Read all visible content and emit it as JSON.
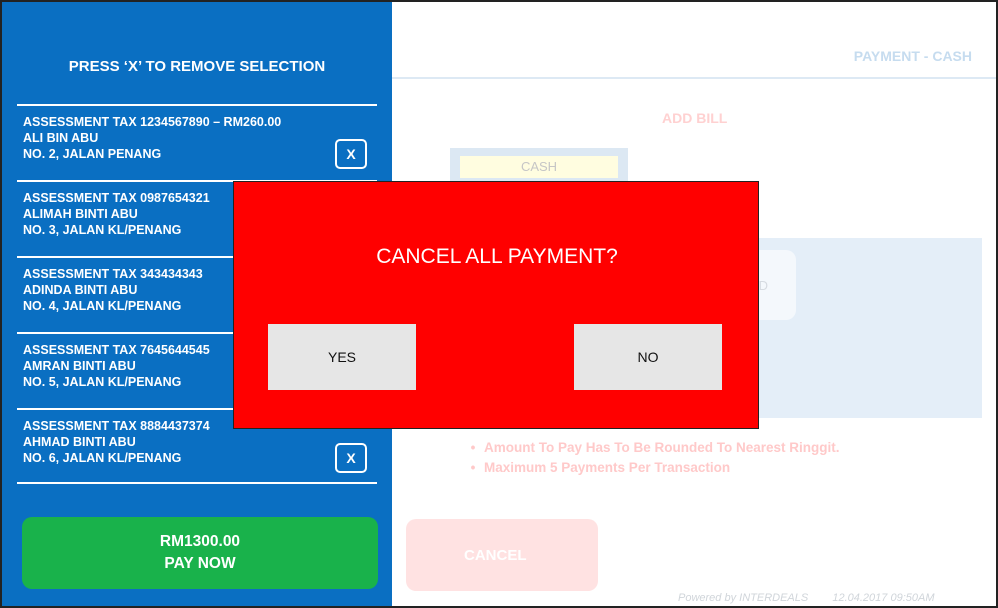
{
  "sidebar": {
    "title": "PRESS ‘X’ TO REMOVE SELECTION",
    "remove_label": "X",
    "bills": [
      {
        "line1": "ASSESSMENT TAX 1234567890   – RM260.00",
        "line2": "ALI BIN ABU",
        "line3": "NO. 2, JALAN PENANG",
        "show_remove": true
      },
      {
        "line1": "ASSESSMENT TAX 0987654321",
        "line2": "ALIMAH BINTI ABU",
        "line3": "NO. 3, JALAN KL/PENANG",
        "show_remove": false
      },
      {
        "line1": "ASSESSMENT TAX 343434343",
        "line2": "ADINDA BINTI ABU",
        "line3": "NO. 4, JALAN KL/PENANG",
        "show_remove": false
      },
      {
        "line1": "ASSESSMENT TAX 7645644545",
        "line2": "AMRAN BINTI ABU",
        "line3": "NO. 5, JALAN KL/PENANG",
        "show_remove": false
      },
      {
        "line1": "ASSESSMENT TAX 8884437374",
        "line2": "AHMAD BINTI ABU",
        "line3": "NO. 6, JALAN KL/PENANG",
        "show_remove": true
      }
    ],
    "total": "RM1300.00",
    "pay_label": "PAY NOW"
  },
  "main": {
    "header": "PAYMENT - CASH",
    "add_bill": "ADD BILL",
    "cash_label": "CASH",
    "panel_button_text": "D",
    "notes": [
      "Amount To Pay Has To Be Rounded To Nearest Ringgit.",
      "Maximum 5 Payments Per Transaction"
    ],
    "cancel_label": "CANCEL",
    "footer_powered": "Powered by INTERDEALS",
    "footer_datetime": "12.04.2017  09:50AM"
  },
  "modal": {
    "title": "CANCEL ALL PAYMENT?",
    "yes_label": "YES",
    "no_label": "NO"
  },
  "colors": {
    "sidebar_bg": "#0a6fc2",
    "pay_button": "#19b24b",
    "modal_bg": "#ff0000"
  }
}
